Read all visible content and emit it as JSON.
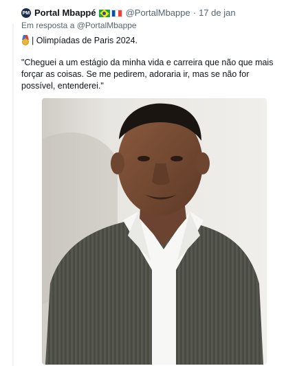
{
  "tweet": {
    "author_name": "Portal Mbappé",
    "author_handle": "@PortalMbappe",
    "separator": "·",
    "date": "17 de jan",
    "reply_to": "Em resposta a @PortalMbappe",
    "line1": "| Olimpíadas de Paris 2024.",
    "quote": "\"Cheguei a um estágio da minha vida e carreira que não que mais forçar as coisas. Se me pedirem, adoraria ir, mas se não for possível, entenderei.\"",
    "flags": [
      "brazil-flag-icon",
      "france-flag-icon"
    ],
    "medal_icon": "medal-icon"
  },
  "colors": {
    "text": "#0f1419",
    "secondary": "#536471",
    "avatar_bg": "#1b2b4a"
  }
}
